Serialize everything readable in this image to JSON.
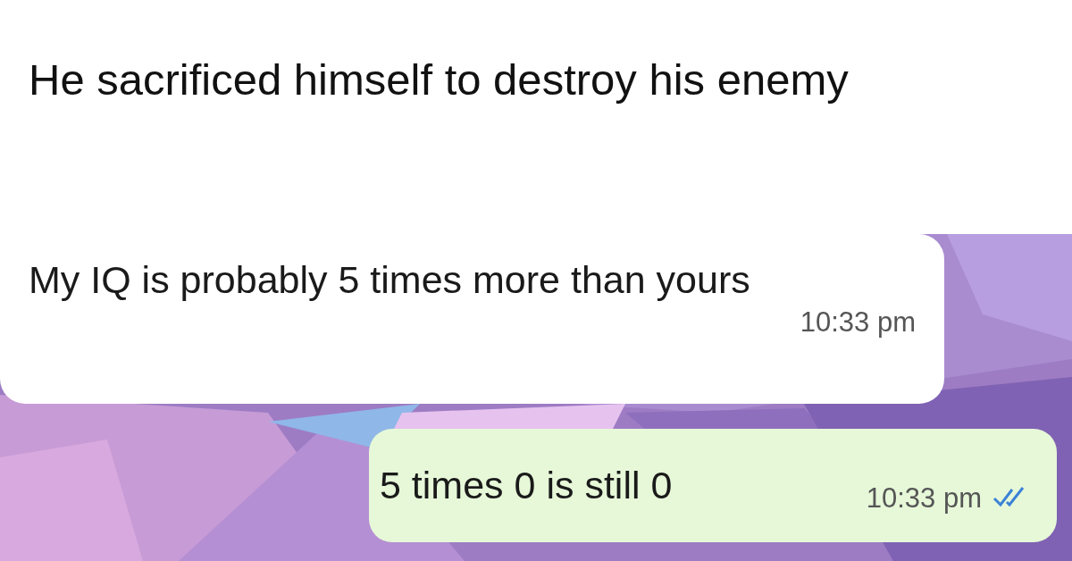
{
  "caption": "He sacrificed himself to destroy his enemy",
  "chat": {
    "messages": [
      {
        "kind": "incoming",
        "text": "My IQ is probably 5 times more than yours",
        "time": "10:33 pm"
      },
      {
        "kind": "outgoing",
        "text": "5 times 0 is still 0",
        "time": "10:33 pm",
        "read": true
      }
    ]
  }
}
